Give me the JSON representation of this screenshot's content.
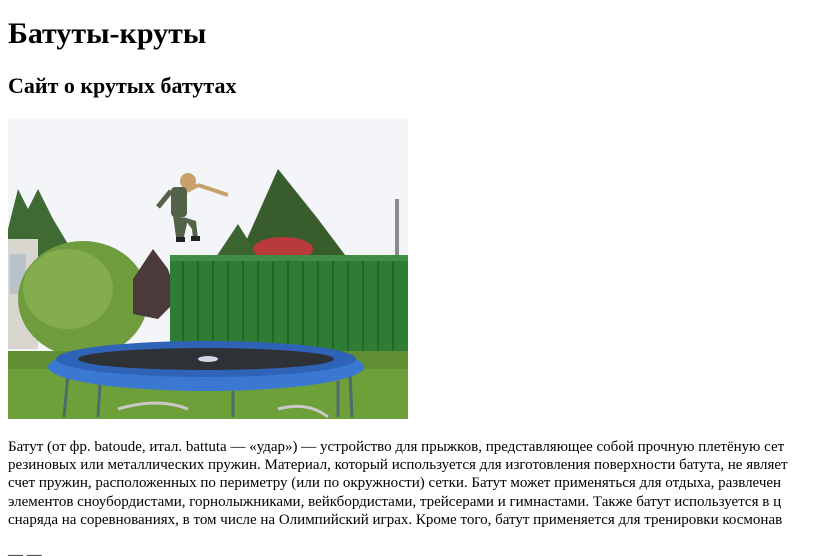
{
  "page": {
    "title": "Батуты-круты",
    "subtitle": "Сайт о крутых батутах",
    "image": {
      "subject": "trampoline-photo"
    },
    "article_lines": [
      "Батут (от фр. batoude, итал. battuta — «удар») — устройство для прыжков, представляющее собой прочную плетёную сет",
      "резиновых или металлических пружин. Материал, который используется для изготовления поверхности батута, не являет",
      "счет пружин, расположенных по периметру (или по окружности) сетки. Батут может применяться для отдыха, развлечен",
      "элементов сноубордистами, горнолыжниками, вейкбордистами, трейсерами и гимнастами. Также батут используется в ц",
      "снаряда на соревнованиях, в том числе на Олимпийский играх. Кроме того, батут применяется для тренировки космонав"
    ],
    "trailer_text": "— —"
  },
  "colors": {
    "background": "#ffffff",
    "text": "#000000",
    "shed": "#2f7d34",
    "trampoline_rim": "#3a78d2",
    "grass": "#5f8f32",
    "sky": "#f2f4f8"
  }
}
